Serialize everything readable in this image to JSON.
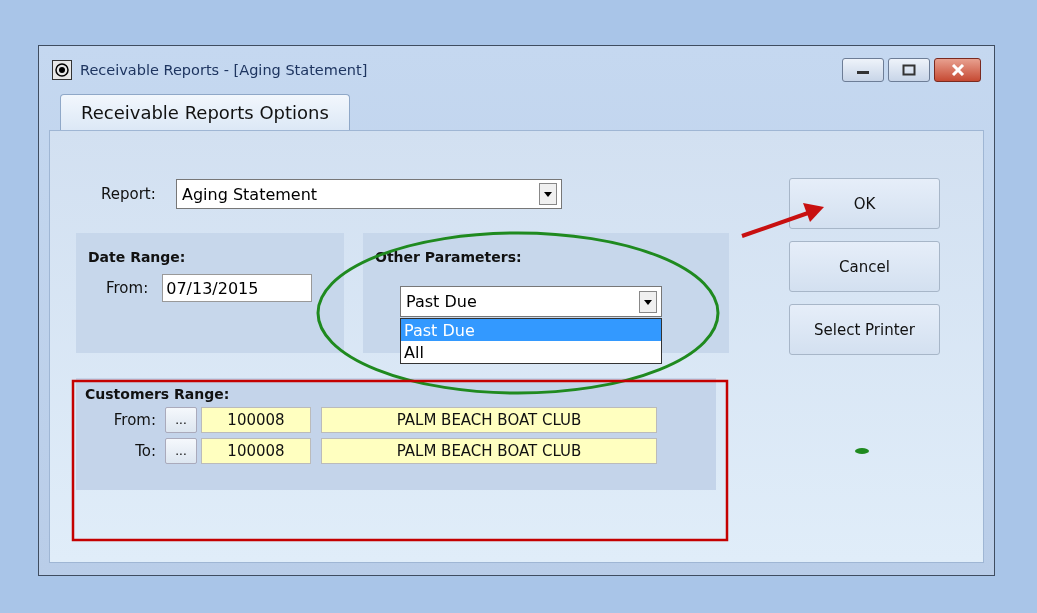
{
  "window": {
    "title": "Receivable Reports - [Aging Statement]"
  },
  "tabs": [
    {
      "label": "Receivable Reports Options",
      "selected": true
    }
  ],
  "report": {
    "label": "Report:",
    "value": "Aging Statement"
  },
  "date_range": {
    "title": "Date Range:",
    "from_label": "From:",
    "from_value": "07/13/2015"
  },
  "other_parameters": {
    "title": "Other Parameters:",
    "value": "Past Due",
    "expanded": true,
    "options": [
      {
        "label": "Past Due",
        "selected": true
      },
      {
        "label": "All",
        "selected": false
      }
    ]
  },
  "customers_range": {
    "title": "Customers Range:",
    "rows": [
      {
        "label": "From:",
        "browse": "...",
        "code": "100008",
        "name": "PALM BEACH BOAT CLUB"
      },
      {
        "label": "To:",
        "browse": "...",
        "code": "100008",
        "name": "PALM BEACH BOAT CLUB"
      }
    ]
  },
  "buttons": [
    "OK",
    "Cancel",
    "Select Printer"
  ],
  "annotations": [
    {
      "kind": "arrow"
    },
    {
      "kind": "ellipse"
    },
    {
      "kind": "rectangle"
    },
    {
      "kind": "dot"
    }
  ]
}
